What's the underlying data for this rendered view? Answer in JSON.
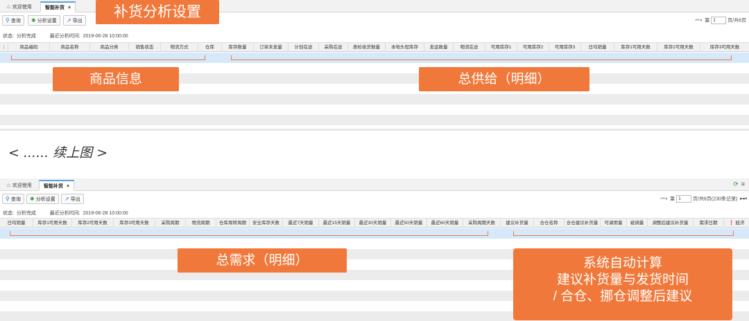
{
  "screen1": {
    "tabs": [
      {
        "icon": "home-icon",
        "label": "欢迎使用"
      },
      {
        "label": "智能补货",
        "close": "×"
      }
    ],
    "toolbar": {
      "query": "查询",
      "settings": "分析设置",
      "export": "导出"
    },
    "pager": {
      "nav_back": "⏮ ◂",
      "prefix": "第",
      "page": "1",
      "suffix": "页/共6页"
    },
    "status": {
      "label": "状态:",
      "value": "分析完成",
      "time_label": "最近分析时间:",
      "time_value": "2019-06-28 10:00:00"
    },
    "columns": [
      "商品编码",
      "商品名称",
      "商品分类",
      "销售状态",
      "物流方式",
      "仓库",
      "库存数量",
      "订单未发量",
      "计划在途",
      "采购在途",
      "质检收货数量",
      "本地头程库存",
      "发运数量",
      "物流在途",
      "可用库存1",
      "可用库存2",
      "可用库存3",
      "日均销量",
      "库存1可用天数",
      "库存2可用天数",
      "库存3可用天数"
    ],
    "callouts": {
      "settings": "补货分析设置",
      "product": "商品信息",
      "supply": "总供给（明细）"
    }
  },
  "continued": "< ...... 续上图 >",
  "screen2": {
    "tabs": [
      {
        "icon": "home-icon",
        "label": "欢迎使用"
      },
      {
        "label": "智能补货",
        "close": "×"
      }
    ],
    "toolbar": {
      "query": "查询",
      "settings": "分析设置",
      "export": "导出"
    },
    "pager": {
      "nav_back": "⏮ ◂",
      "prefix": "第",
      "page": "1",
      "suffix": "页/共6页(230条记录)",
      "nav_fwd": "▸ ⏭"
    },
    "status": {
      "label": "状态:",
      "value": "分析完成",
      "time_label": "最近分析时间:",
      "time_value": "2019-06-28 10:00:00"
    },
    "columns": [
      "日均销量",
      "库存1可用天数",
      "库存2可用天数",
      "库存3可用天数",
      "采购周期",
      "物流周期",
      "仓库周转周期",
      "安全库存天数",
      "最近7天销量",
      "最近15天销量",
      "最近30天销量",
      "最近50天销量",
      "最近60天销量",
      "采购周期天数",
      "建议补货量",
      "合仓名称",
      "合仓建议补货量",
      "可调用量",
      "被调量",
      "调整后建议补货量",
      "需求日期",
      "经济"
    ],
    "callouts": {
      "demand": "总需求（明细）",
      "system_line1": "系统自动计算",
      "system_line2": "建议补货量与发货时间",
      "system_line3": "/ 合仓、挪仓调整后建议"
    }
  }
}
